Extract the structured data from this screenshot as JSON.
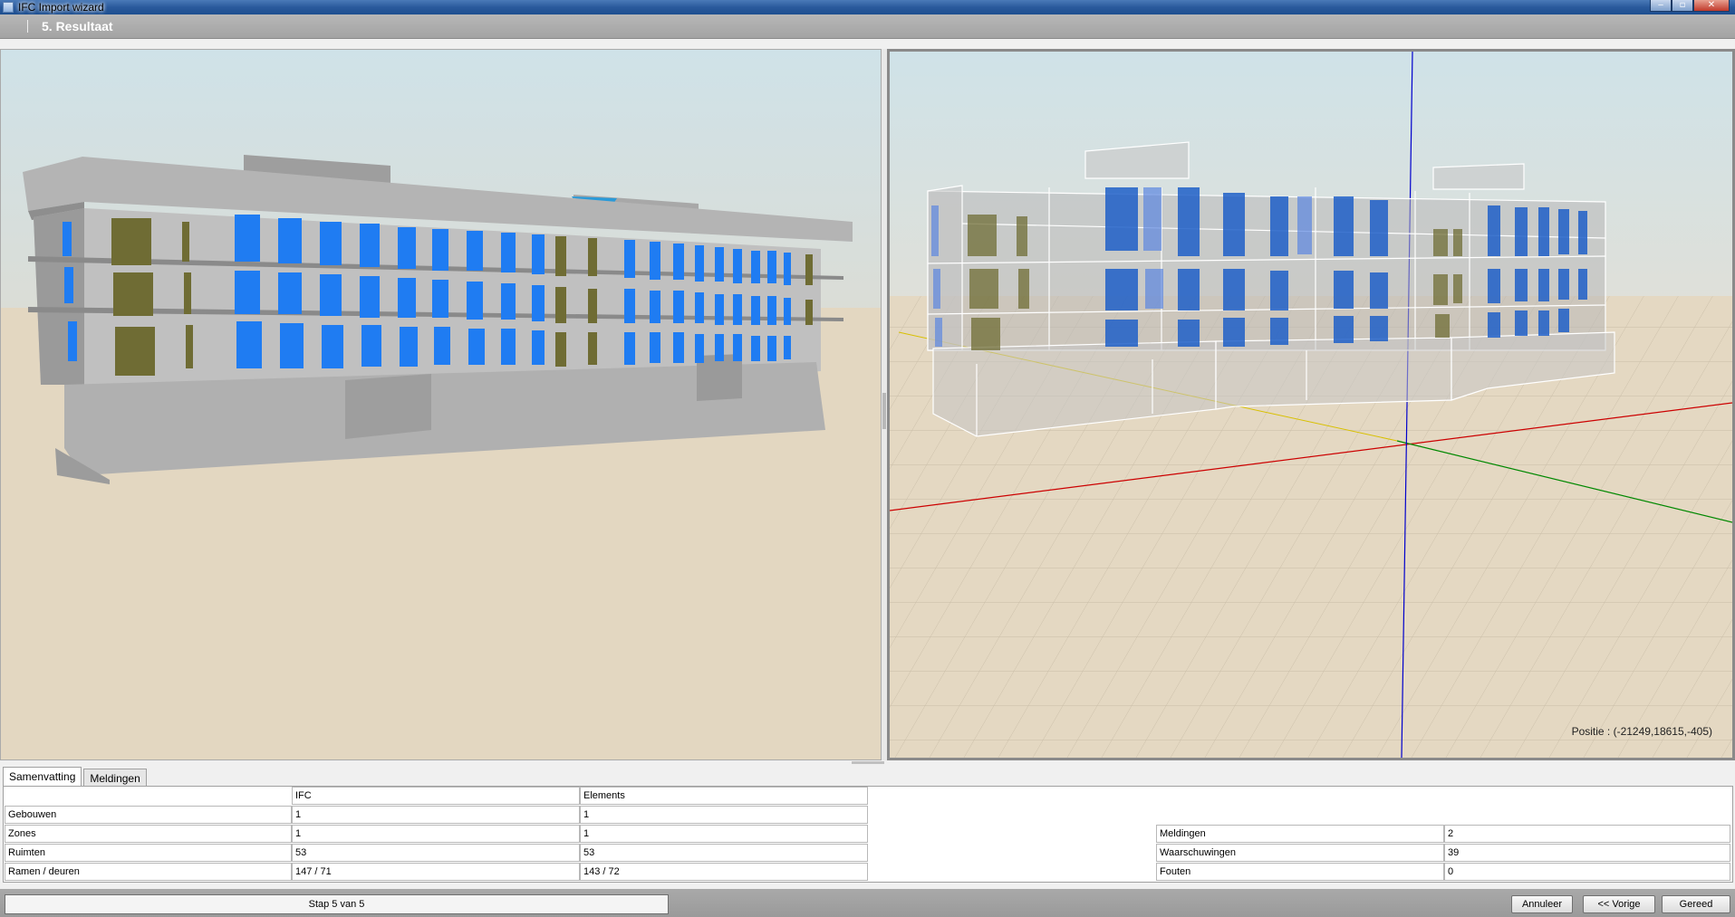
{
  "window": {
    "title": "IFC Import wizard",
    "buttons": {
      "minimize": "‒",
      "maximize": "▫",
      "close": "✕"
    }
  },
  "step": {
    "title": "5. Resultaat"
  },
  "viewer": {
    "position_readout": "Positie : (-21249,18615,-405)"
  },
  "tabs": [
    {
      "label": "Samenvatting",
      "active": true
    },
    {
      "label": "Meldingen",
      "active": false
    }
  ],
  "summary": {
    "headers": {
      "ifc": "IFC",
      "elements": "Elements"
    },
    "rows": [
      {
        "label": "Gebouwen",
        "ifc": "1",
        "elements": "1"
      },
      {
        "label": "Zones",
        "ifc": "1",
        "elements": "1"
      },
      {
        "label": "Ruimten",
        "ifc": "53",
        "elements": "53"
      },
      {
        "label": "Ramen / deuren",
        "ifc": "147 / 71",
        "elements": "143 / 72"
      }
    ]
  },
  "messages": [
    {
      "label": "Meldingen",
      "value": "2"
    },
    {
      "label": "Waarschuwingen",
      "value": "39"
    },
    {
      "label": "Fouten",
      "value": "0"
    }
  ],
  "footer": {
    "step_indicator": "Stap 5 van 5",
    "cancel": "Annuleer",
    "previous": "<< Vorige",
    "finish": "Gereed"
  },
  "colors": {
    "window_glass": "#1e7cf0",
    "door_panel": "#6f6c34",
    "building_grey": "#b8b8b8",
    "sky_top": "#cfe0e6",
    "ground": "#e4d8c2",
    "axis_x": "#cc0000",
    "axis_y": "#008800",
    "axis_z": "#0000cc"
  }
}
